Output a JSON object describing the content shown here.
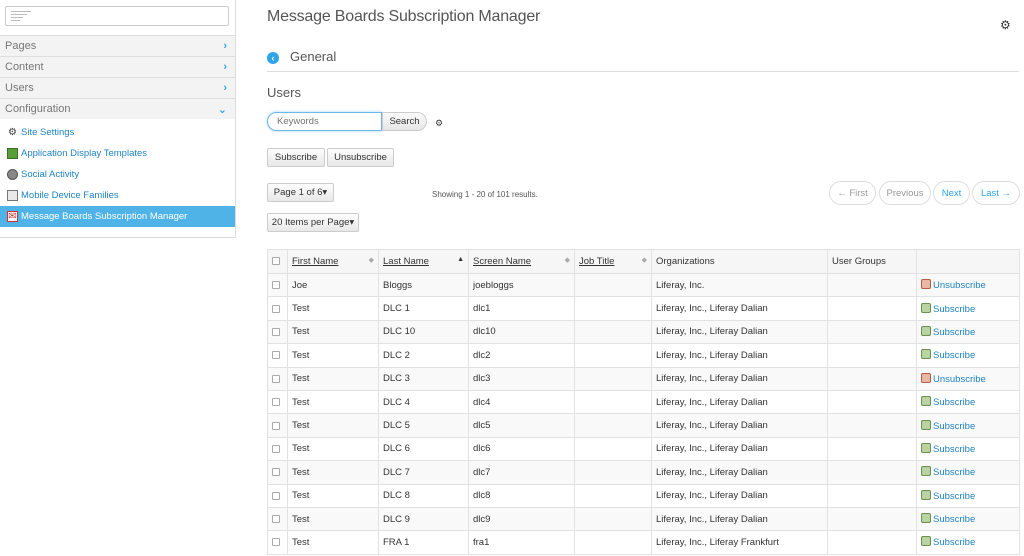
{
  "sidebar": {
    "sections": [
      {
        "label": "Pages",
        "icon": "chevron-right-icon",
        "glyph": "›"
      },
      {
        "label": "Content",
        "icon": "chevron-right-icon",
        "glyph": "›"
      },
      {
        "label": "Users",
        "icon": "chevron-right-icon",
        "glyph": "›"
      },
      {
        "label": "Configuration",
        "icon": "chevron-down-icon",
        "glyph": "⌄"
      }
    ],
    "items": [
      {
        "label": "Site Settings",
        "icon": "gear-icon"
      },
      {
        "label": "Application Display Templates",
        "icon": "app-templates-icon"
      },
      {
        "label": "Social Activity",
        "icon": "social-activity-icon"
      },
      {
        "label": "Mobile Device Families",
        "icon": "mobile-device-icon"
      },
      {
        "label": "Message Boards Subscription Manager",
        "icon": "message-boards-icon"
      }
    ]
  },
  "header": {
    "title": "Message Boards Subscription Manager",
    "section": "General"
  },
  "users": {
    "heading": "Users",
    "search_placeholder": "Keywords",
    "search_label": "Search",
    "subscribe_label": "Subscribe",
    "unsubscribe_label": "Unsubscribe"
  },
  "pagination": {
    "page_label": "Page 1 of 6",
    "items_per_page_label": "20 Items per Page",
    "showing": "Showing 1 - 20 of 101 results.",
    "first": "← First",
    "previous": "Previous",
    "next": "Next",
    "last": "Last →"
  },
  "table": {
    "columns": [
      "First Name",
      "Last Name",
      "Screen Name",
      "Job Title",
      "Organizations",
      "User Groups",
      ""
    ],
    "rows": [
      {
        "first": "Joe",
        "last": "Bloggs",
        "screen": "joebloggs",
        "job": "",
        "org": "Liferay, Inc.",
        "groups": "",
        "action": "Unsubscribe"
      },
      {
        "first": "Test",
        "last": "DLC 1",
        "screen": "dlc1",
        "job": "",
        "org": "Liferay, Inc., Liferay Dalian",
        "groups": "",
        "action": "Subscribe"
      },
      {
        "first": "Test",
        "last": "DLC 10",
        "screen": "dlc10",
        "job": "",
        "org": "Liferay, Inc., Liferay Dalian",
        "groups": "",
        "action": "Subscribe"
      },
      {
        "first": "Test",
        "last": "DLC 2",
        "screen": "dlc2",
        "job": "",
        "org": "Liferay, Inc., Liferay Dalian",
        "groups": "",
        "action": "Subscribe"
      },
      {
        "first": "Test",
        "last": "DLC 3",
        "screen": "dlc3",
        "job": "",
        "org": "Liferay, Inc., Liferay Dalian",
        "groups": "",
        "action": "Unsubscribe"
      },
      {
        "first": "Test",
        "last": "DLC 4",
        "screen": "dlc4",
        "job": "",
        "org": "Liferay, Inc., Liferay Dalian",
        "groups": "",
        "action": "Subscribe"
      },
      {
        "first": "Test",
        "last": "DLC 5",
        "screen": "dlc5",
        "job": "",
        "org": "Liferay, Inc., Liferay Dalian",
        "groups": "",
        "action": "Subscribe"
      },
      {
        "first": "Test",
        "last": "DLC 6",
        "screen": "dlc6",
        "job": "",
        "org": "Liferay, Inc., Liferay Dalian",
        "groups": "",
        "action": "Subscribe"
      },
      {
        "first": "Test",
        "last": "DLC 7",
        "screen": "dlc7",
        "job": "",
        "org": "Liferay, Inc., Liferay Dalian",
        "groups": "",
        "action": "Subscribe"
      },
      {
        "first": "Test",
        "last": "DLC 8",
        "screen": "dlc8",
        "job": "",
        "org": "Liferay, Inc., Liferay Dalian",
        "groups": "",
        "action": "Subscribe"
      },
      {
        "first": "Test",
        "last": "DLC 9",
        "screen": "dlc9",
        "job": "",
        "org": "Liferay, Inc., Liferay Dalian",
        "groups": "",
        "action": "Subscribe"
      },
      {
        "first": "Test",
        "last": "FRA 1",
        "screen": "fra1",
        "job": "",
        "org": "Liferay, Inc., Liferay Frankfurt",
        "groups": "",
        "action": "Subscribe"
      }
    ]
  },
  "colors": {
    "accent": "#2fa4e7",
    "link": "#1f83c3",
    "active_item": "#4fb3e8"
  }
}
